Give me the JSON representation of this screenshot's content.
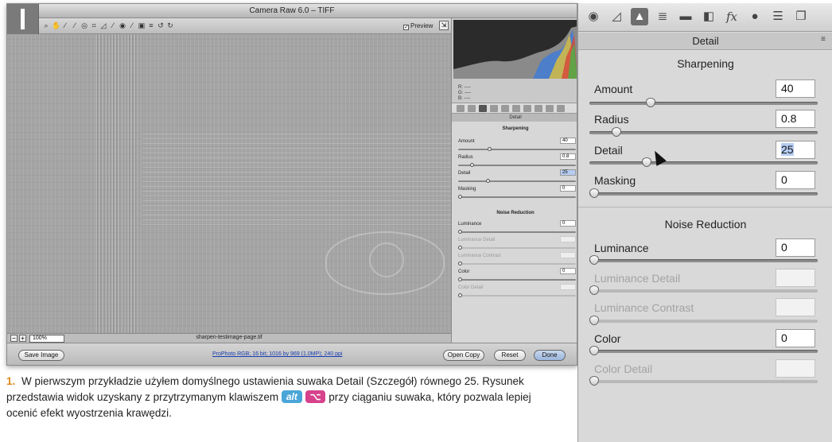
{
  "window": {
    "title": "Camera Raw 6.0  –  TIFF",
    "preview_label": "Preview",
    "preview_checked": "✓",
    "zoom": "100%",
    "filename": "sharpen-testimage-page.tif",
    "workflow": "ProPhoto RGB; 16 bit; 1016 by 969 (1.0MP); 240 ppi",
    "buttons": {
      "save": "Save Image",
      "open": "Open Copy",
      "reset": "Reset",
      "done": "Done"
    },
    "rgb_readout": [
      "R: ----",
      "G: ----",
      "B: ----"
    ],
    "mini_panel_title": "Detail"
  },
  "panel": {
    "title": "Detail",
    "menu_icon": "≡",
    "tabs": [
      {
        "icon": "basic-icon",
        "glyph": "◉",
        "active": false
      },
      {
        "icon": "tone-curve-icon",
        "glyph": "◿",
        "active": false
      },
      {
        "icon": "detail-icon",
        "glyph": "▲",
        "active": true
      },
      {
        "icon": "hsl-icon",
        "glyph": "≣",
        "active": false
      },
      {
        "icon": "split-toning-icon",
        "glyph": "▬",
        "active": false
      },
      {
        "icon": "lens-corrections-icon",
        "glyph": "◧",
        "active": false
      },
      {
        "icon": "effects-icon",
        "glyph": "fx",
        "active": false
      },
      {
        "icon": "camera-calibration-icon",
        "glyph": "●",
        "active": false
      },
      {
        "icon": "presets-icon",
        "glyph": "☰",
        "active": false
      },
      {
        "icon": "snapshots-icon",
        "glyph": "❐",
        "active": false
      }
    ],
    "sharpening": {
      "title": "Sharpening",
      "amount": {
        "label": "Amount",
        "value": "40",
        "level": 0.27
      },
      "radius": {
        "label": "Radius",
        "value": "0.8",
        "level": 0.12
      },
      "detail": {
        "label": "Detail",
        "value": "25",
        "level": 0.25
      },
      "masking": {
        "label": "Masking",
        "value": "0",
        "level": 0.0
      }
    },
    "noise": {
      "title": "Noise Reduction",
      "luminance": {
        "label": "Luminance",
        "value": "0",
        "level": 0.0
      },
      "luminance_detail": {
        "label": "Luminance Detail",
        "value": "",
        "level": 0.0
      },
      "luminance_contrast": {
        "label": "Luminance Contrast",
        "value": "",
        "level": 0.0
      },
      "color": {
        "label": "Color",
        "value": "0",
        "level": 0.0
      },
      "color_detail": {
        "label": "Color Detail",
        "value": "",
        "level": 0.0
      }
    }
  },
  "caption": {
    "number": "1.",
    "text_before": "W pierwszym przykładzie użyłem domyślnego ustawienia suwaka Detail (Szczegół) równego 25. Rysunek przedstawia widok uzyskany z przytrzymanym klawiszem",
    "key_alt": "alt",
    "key_option": "⌥",
    "text_after": "przy ciąganiu suwaka, który pozwala lepiej ocenić efekt wyostrzenia krawędzi."
  }
}
